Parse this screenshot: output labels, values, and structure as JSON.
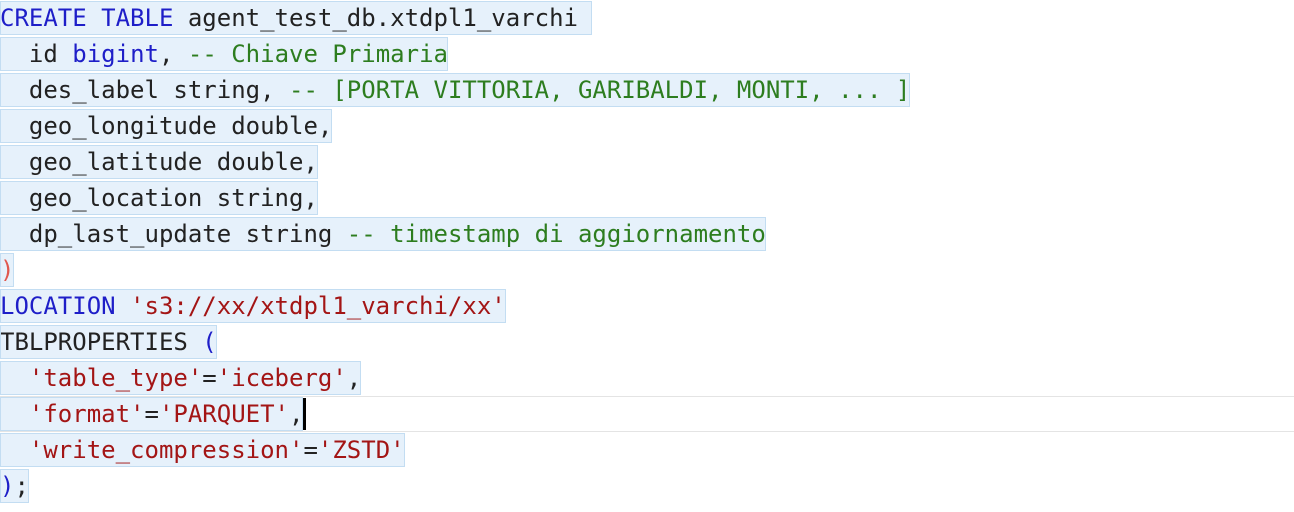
{
  "editor": {
    "lines": [
      {
        "parts": [
          "CREATE TABLE",
          " agent_test_db.xtdpl1_varchi"
        ]
      },
      {
        "parts": [
          "id ",
          "bigint",
          ", ",
          "-- Chiave Primaria"
        ]
      },
      {
        "parts": [
          "des_label string, ",
          "-- [PORTA VITTORIA, GARIBALDI, MONTI, ... ]"
        ]
      },
      {
        "parts": [
          "geo_longitude double,"
        ]
      },
      {
        "parts": [
          "geo_latitude double,"
        ]
      },
      {
        "parts": [
          "geo_location string,"
        ]
      },
      {
        "parts": [
          "dp_last_update string ",
          "-- timestamp di aggiornamento"
        ]
      },
      {
        "parts": [
          ")"
        ]
      },
      {
        "parts": [
          "LOCATION",
          " ",
          "'s3://xx/xtdpl1_varchi/xx'"
        ]
      },
      {
        "parts": [
          "TBLPROPERTIES ",
          "("
        ]
      },
      {
        "parts": [
          "'table_type'",
          "=",
          "'iceberg'",
          ","
        ]
      },
      {
        "parts": [
          "'format'",
          "=",
          "'PARQUET'",
          ","
        ]
      },
      {
        "parts": [
          "'write_compression'",
          "=",
          "'ZSTD'"
        ]
      },
      {
        "parts": [
          ")",
          ";"
        ]
      }
    ]
  },
  "colors": {
    "keyword": "#1e1ec8",
    "comment": "#2d7d1f",
    "string": "#a31515",
    "selection": "#e6f1fb"
  }
}
